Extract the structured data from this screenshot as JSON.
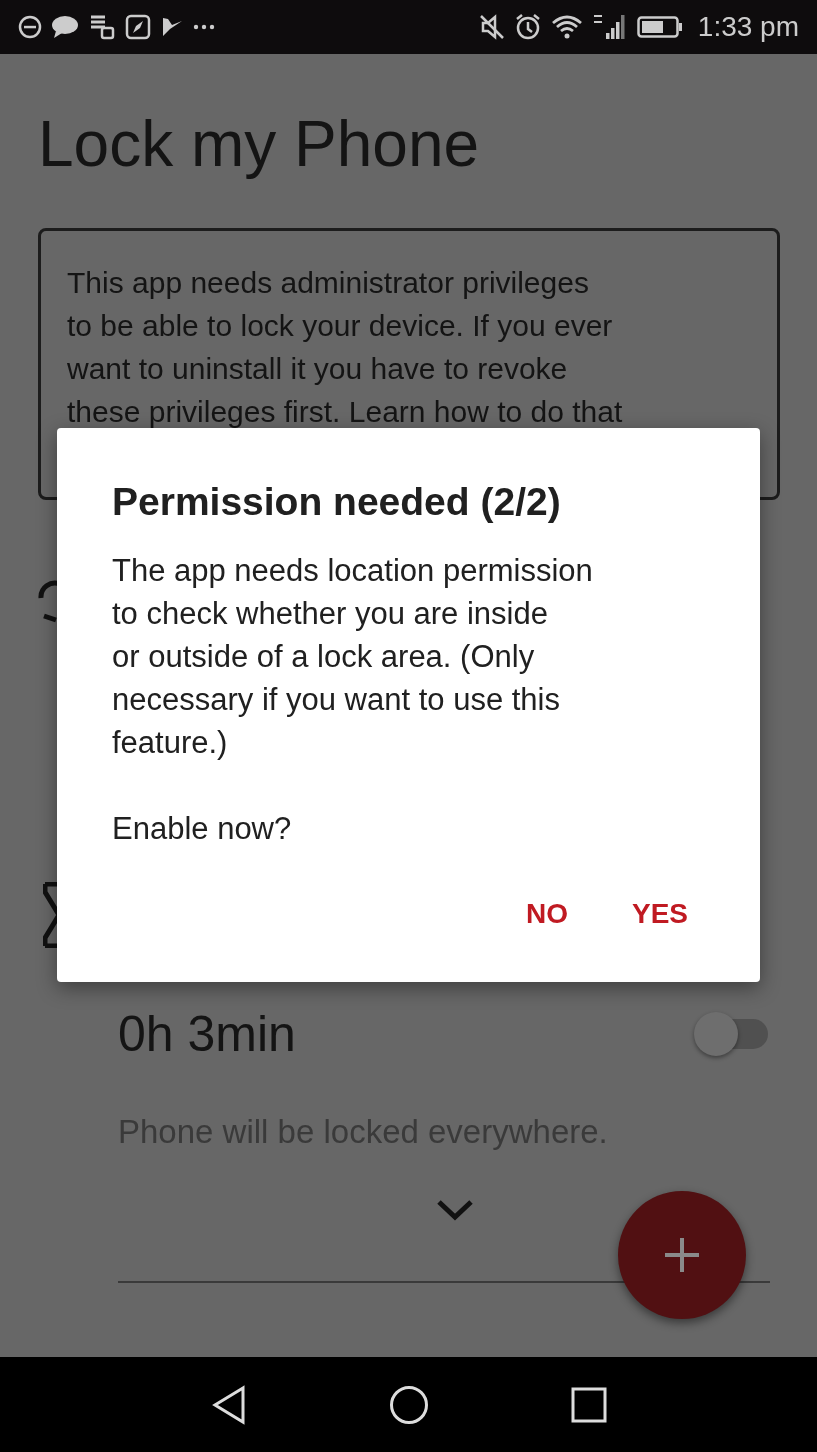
{
  "status_bar": {
    "time": "1:33 pm"
  },
  "app": {
    "title": "Lock my Phone",
    "info_lines": [
      "This app needs administrator privileges",
      "to be able to lock your device. If you ever",
      "want to uninstall it you have to revoke",
      "these privileges first. Learn how to do that"
    ]
  },
  "timer": {
    "duration": "0h 3min",
    "on": false,
    "description": "Phone will be locked everywhere."
  },
  "dialog": {
    "title": "Permission needed (2/2)",
    "message_lines": [
      "The app needs location permission",
      "to check whether you are inside",
      "or outside of a lock area. (Only",
      "necessary if you want to use this",
      "feature.)"
    ],
    "prompt": "Enable now?",
    "buttons": [
      {
        "label": "NO"
      },
      {
        "label": "YES"
      }
    ]
  }
}
